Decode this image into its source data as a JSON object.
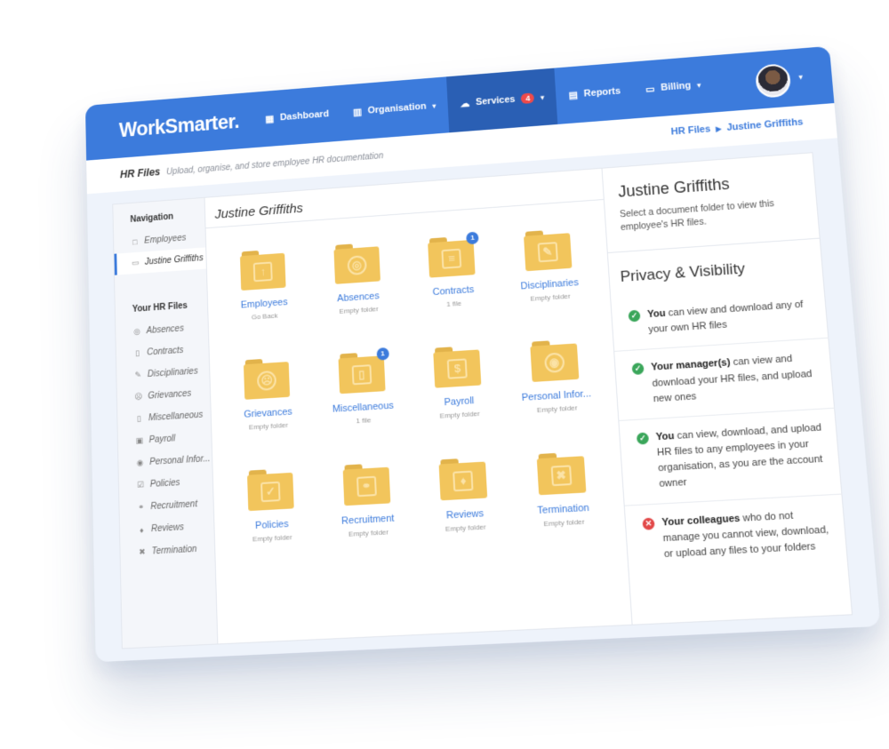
{
  "app": {
    "logo": "WorkSmarter."
  },
  "nav": [
    {
      "label": "Dashboard",
      "icon": "dashboard-icon",
      "glyph": "▦",
      "active": false
    },
    {
      "label": "Organisation",
      "icon": "building-icon",
      "glyph": "▥",
      "active": false,
      "caret": true
    },
    {
      "label": "Services",
      "icon": "services-icon",
      "glyph": "☁",
      "active": true,
      "badge": "4",
      "caret": true
    },
    {
      "label": "Reports",
      "icon": "reports-icon",
      "glyph": "▤",
      "active": false
    },
    {
      "label": "Billing",
      "icon": "billing-icon",
      "glyph": "▭",
      "active": false,
      "caret": true
    }
  ],
  "subheader": {
    "title": "HR Files",
    "description": "Upload, organise, and store employee HR documentation"
  },
  "breadcrumb": {
    "root": "HR Files",
    "current": "Justine Griffiths"
  },
  "sidebar": {
    "navigation_heading": "Navigation",
    "navigation_items": [
      {
        "label": "Employees",
        "icon": "folder-icon",
        "glyph": "□",
        "active": false
      },
      {
        "label": "Justine Griffiths",
        "icon": "folder-open-icon",
        "glyph": "▭",
        "active": true
      }
    ],
    "files_heading": "Your HR Files",
    "file_items": [
      {
        "label": "Absences",
        "icon": "stethoscope-icon",
        "glyph": "◎"
      },
      {
        "label": "Contracts",
        "icon": "document-icon",
        "glyph": "▯"
      },
      {
        "label": "Disciplinaries",
        "icon": "gavel-icon",
        "glyph": "✎"
      },
      {
        "label": "Grievances",
        "icon": "frown-icon",
        "glyph": "☹"
      },
      {
        "label": "Miscellaneous",
        "icon": "file-icon",
        "glyph": "▯"
      },
      {
        "label": "Payroll",
        "icon": "money-icon",
        "glyph": "▣"
      },
      {
        "label": "Personal Infor...",
        "icon": "user-icon",
        "glyph": "◉"
      },
      {
        "label": "Policies",
        "icon": "checkbox-icon",
        "glyph": "☑"
      },
      {
        "label": "Recruitment",
        "icon": "handshake-icon",
        "glyph": "⚭"
      },
      {
        "label": "Reviews",
        "icon": "thumbs-up-icon",
        "glyph": "♦"
      },
      {
        "label": "Termination",
        "icon": "x-icon",
        "glyph": "✖"
      }
    ]
  },
  "main": {
    "title": "Justine Griffiths",
    "folders": [
      {
        "name": "Employees",
        "sub": "Go Back",
        "icon": "folder-back-icon",
        "glyph": "↑",
        "count": ""
      },
      {
        "name": "Absences",
        "sub": "Empty folder",
        "icon": "folder-stethoscope-icon",
        "glyph": "◎",
        "count": ""
      },
      {
        "name": "Contracts",
        "sub": "1 file",
        "icon": "folder-document-icon",
        "glyph": "≡",
        "count": "1"
      },
      {
        "name": "Disciplinaries",
        "sub": "Empty folder",
        "icon": "folder-gavel-icon",
        "glyph": "✎",
        "count": ""
      },
      {
        "name": "Grievances",
        "sub": "Empty folder",
        "icon": "folder-frown-icon",
        "glyph": "☹",
        "count": ""
      },
      {
        "name": "Miscellaneous",
        "sub": "1 file",
        "icon": "folder-file-icon",
        "glyph": "▯",
        "count": "1"
      },
      {
        "name": "Payroll",
        "sub": "Empty folder",
        "icon": "folder-money-icon",
        "glyph": "$",
        "count": ""
      },
      {
        "name": "Personal Infor...",
        "sub": "Empty folder",
        "icon": "folder-user-icon",
        "glyph": "◉",
        "count": ""
      },
      {
        "name": "Policies",
        "sub": "Empty folder",
        "icon": "folder-checkbox-icon",
        "glyph": "✓",
        "count": ""
      },
      {
        "name": "Recruitment",
        "sub": "Empty folder",
        "icon": "folder-handshake-icon",
        "glyph": "⚭",
        "count": ""
      },
      {
        "name": "Reviews",
        "sub": "Empty folder",
        "icon": "folder-thumbs-up-icon",
        "glyph": "♦",
        "count": ""
      },
      {
        "name": "Termination",
        "sub": "Empty folder",
        "icon": "folder-x-icon",
        "glyph": "✖",
        "count": ""
      }
    ]
  },
  "right_panel": {
    "title": "Justine Griffiths",
    "description": "Select a document folder to view this employee's HR files.",
    "privacy_title": "Privacy & Visibility",
    "privacy_items": [
      {
        "status": "ok",
        "strong": "You",
        "text": " can view and download any of your own HR files"
      },
      {
        "status": "ok",
        "strong": "Your manager(s)",
        "text": " can view and download your HR files, and upload new ones"
      },
      {
        "status": "ok",
        "strong": "You",
        "text": " can view, download, and upload HR files to any employees in your organisation, as you are the account owner"
      },
      {
        "status": "no",
        "strong": "Your colleagues",
        "text": " who do not manage you cannot view, download, or upload any files to your folders"
      }
    ]
  },
  "colors": {
    "accent": "#3c7bdc",
    "folder": "#f2c55c",
    "ok": "#3aa65a",
    "error": "#e24848"
  }
}
